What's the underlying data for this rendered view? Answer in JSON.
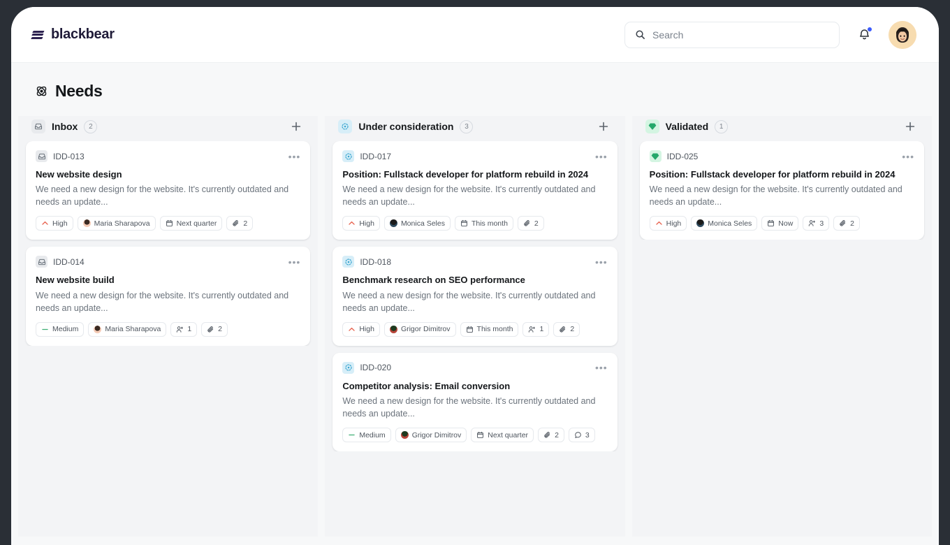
{
  "brand": {
    "name": "blackbear",
    "logo_icon": "slashes-logo-icon"
  },
  "header": {
    "search": {
      "placeholder": "Search",
      "icon": "search-icon"
    },
    "notifications": {
      "icon": "bell-icon",
      "has_unread": true,
      "dot_color": "#3b5bfd"
    },
    "avatar": {
      "icon": "user-avatar",
      "bg_color": "#f6d9ad"
    }
  },
  "page": {
    "title": "Needs",
    "icon": "atom-icon"
  },
  "columns": [
    {
      "id": "inbox",
      "title": "Inbox",
      "count": "2",
      "icon": "inbox-icon",
      "chip_class": "chip-gray",
      "chip_color": "#e8eaed",
      "icon_color": "#6b737c",
      "add_label": "+",
      "cards": [
        {
          "id": "IDD-013",
          "title": "New website design",
          "description": "We need a new design for the website. It's currently outdated and needs an update...",
          "menu": "•••",
          "badges": [
            {
              "type": "priority",
              "label": "High",
              "icon": "chevron-up-icon",
              "color": "#e8614d"
            },
            {
              "type": "assignee",
              "label": "Maria Sharapova",
              "icon": "avatar-icon",
              "avatar_class": "av-maria"
            },
            {
              "type": "date",
              "label": "Next quarter",
              "icon": "calendar-icon"
            },
            {
              "type": "attachments",
              "label": "2",
              "icon": "paperclip-icon"
            }
          ]
        },
        {
          "id": "IDD-014",
          "title": "New website build",
          "description": "We need a new design for the website. It's currently outdated and needs an update...",
          "menu": "•••",
          "badges": [
            {
              "type": "priority",
              "label": "Medium",
              "icon": "minus-icon",
              "color": "#3fae74"
            },
            {
              "type": "assignee",
              "label": "Maria Sharapova",
              "icon": "avatar-icon",
              "avatar_class": "av-maria"
            },
            {
              "type": "people",
              "label": "1",
              "icon": "user-plus-icon"
            },
            {
              "type": "attachments",
              "label": "2",
              "icon": "paperclip-icon"
            }
          ]
        }
      ]
    },
    {
      "id": "under-consideration",
      "title": "Under consideration",
      "count": "3",
      "icon": "loader-circle-icon",
      "chip_class": "chip-blue",
      "chip_color": "#d7eef8",
      "icon_color": "#3aa6d0",
      "add_label": "+",
      "cards": [
        {
          "id": "IDD-017",
          "title": "Position: Fullstack developer for platform rebuild in 2024",
          "description": "We need a new design for the website. It's currently outdated and needs an update...",
          "menu": "•••",
          "badges": [
            {
              "type": "priority",
              "label": "High",
              "icon": "chevron-up-icon",
              "color": "#e8614d"
            },
            {
              "type": "assignee",
              "label": "Monica Seles",
              "icon": "avatar-icon",
              "avatar_class": "av-monica"
            },
            {
              "type": "date",
              "label": "This month",
              "icon": "calendar-icon"
            },
            {
              "type": "attachments",
              "label": "2",
              "icon": "paperclip-icon"
            }
          ]
        },
        {
          "id": "IDD-018",
          "title": "Benchmark research on SEO performance",
          "description": "We need a new design for the website. It's currently outdated and needs an update...",
          "menu": "•••",
          "badges": [
            {
              "type": "priority",
              "label": "High",
              "icon": "chevron-up-icon",
              "color": "#e8614d"
            },
            {
              "type": "assignee",
              "label": "Grigor Dimitrov",
              "icon": "avatar-icon",
              "avatar_class": "av-grigor"
            },
            {
              "type": "date",
              "label": "This month",
              "icon": "calendar-icon"
            },
            {
              "type": "people",
              "label": "1",
              "icon": "user-plus-icon"
            },
            {
              "type": "attachments",
              "label": "2",
              "icon": "paperclip-icon"
            }
          ]
        },
        {
          "id": "IDD-020",
          "title": "Competitor analysis: Email conversion",
          "description": "We need a new design for the website. It's currently outdated and needs an update...",
          "menu": "•••",
          "badges": [
            {
              "type": "priority",
              "label": "Medium",
              "icon": "minus-icon",
              "color": "#3fae74"
            },
            {
              "type": "assignee",
              "label": "Grigor Dimitrov",
              "icon": "avatar-icon",
              "avatar_class": "av-grigor"
            },
            {
              "type": "date",
              "label": "Next quarter",
              "icon": "calendar-icon"
            },
            {
              "type": "attachments",
              "label": "2",
              "icon": "paperclip-icon"
            },
            {
              "type": "comments",
              "label": "3",
              "icon": "comment-icon"
            }
          ]
        }
      ]
    },
    {
      "id": "validated",
      "title": "Validated",
      "count": "1",
      "icon": "gem-icon",
      "chip_class": "chip-green",
      "chip_color": "#d4f5e2",
      "icon_color": "#24a86a",
      "add_label": "+",
      "cards": [
        {
          "id": "IDD-025",
          "title": "Position: Fullstack developer for platform rebuild in 2024",
          "description": "We need a new design for the website. It's currently outdated and needs an update...",
          "menu": "•••",
          "badges": [
            {
              "type": "priority",
              "label": "High",
              "icon": "chevron-up-icon",
              "color": "#e8614d"
            },
            {
              "type": "assignee",
              "label": "Monica Seles",
              "icon": "avatar-icon",
              "avatar_class": "av-monica"
            },
            {
              "type": "date",
              "label": "Now",
              "icon": "calendar-icon"
            },
            {
              "type": "people",
              "label": "3",
              "icon": "user-plus-icon"
            },
            {
              "type": "attachments",
              "label": "2",
              "icon": "paperclip-icon"
            }
          ]
        }
      ]
    }
  ]
}
